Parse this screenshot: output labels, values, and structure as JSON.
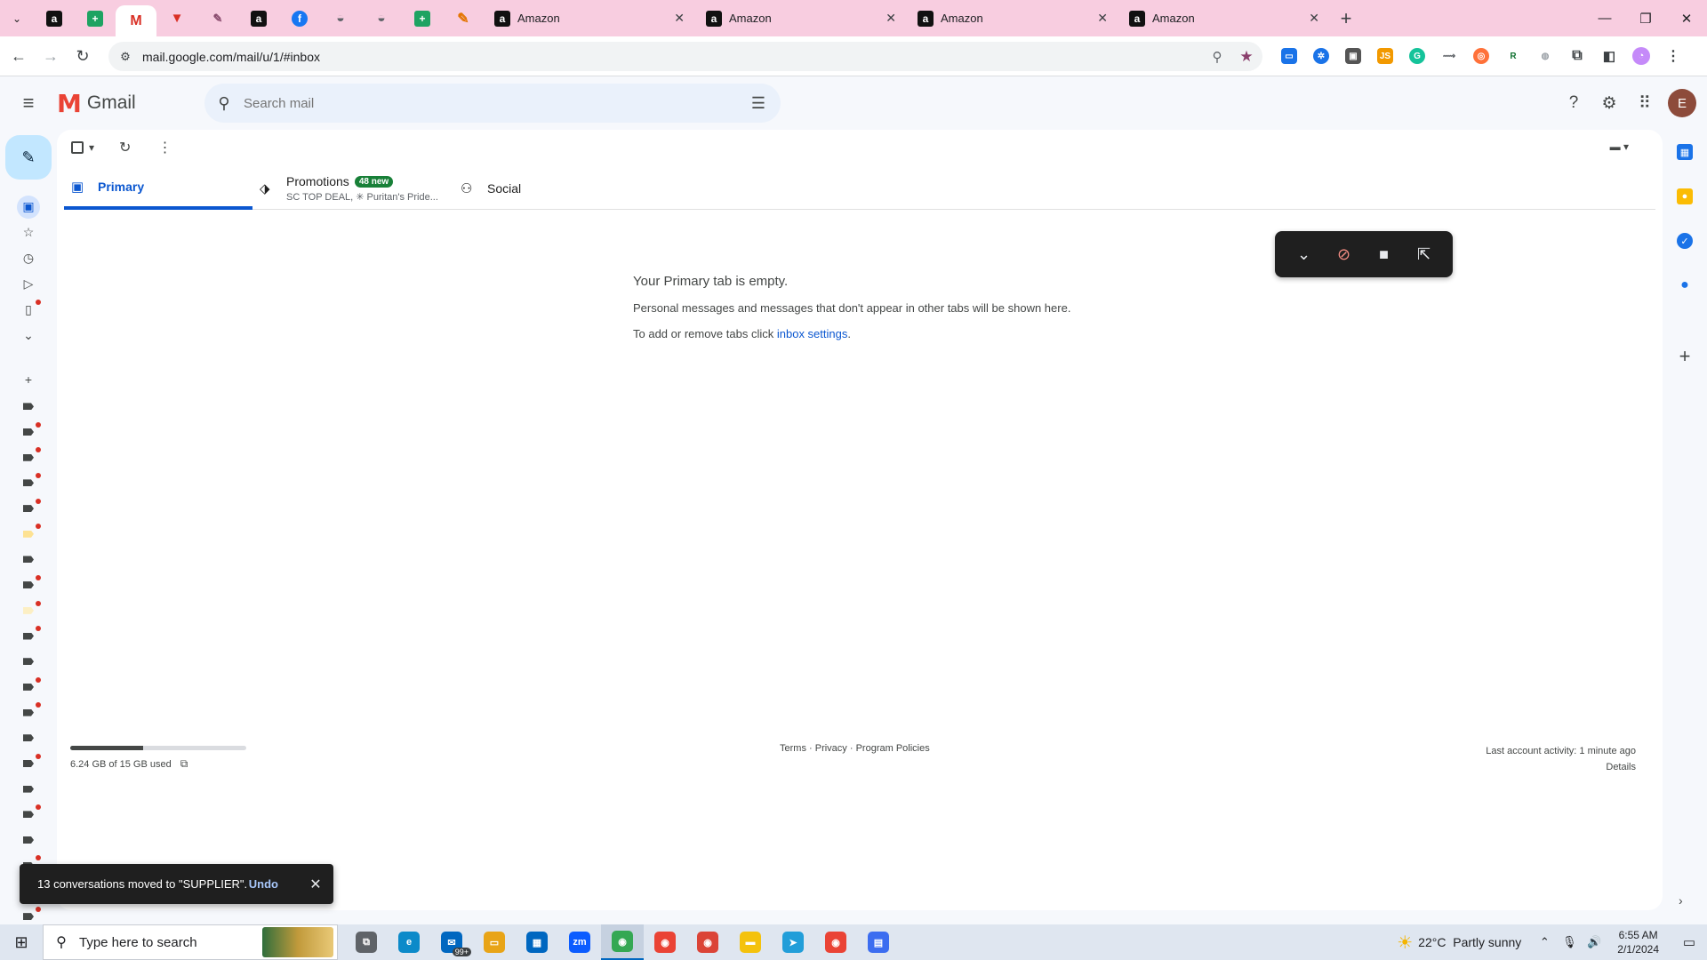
{
  "browser": {
    "pinned_tabs": [
      {
        "icon": "amazon-icon",
        "glyph": "a"
      },
      {
        "icon": "sheets-icon",
        "glyph": "+"
      },
      {
        "icon": "gmail-icon",
        "glyph": "M"
      },
      {
        "icon": "red-v-icon",
        "glyph": "▼"
      },
      {
        "icon": "ms-icon",
        "glyph": "✎"
      },
      {
        "icon": "amazon-icon",
        "glyph": "a"
      },
      {
        "icon": "facebook-icon",
        "glyph": "f"
      },
      {
        "icon": "globe-icon",
        "glyph": "◒"
      },
      {
        "icon": "globe-icon",
        "glyph": "◒"
      },
      {
        "icon": "sheets-icon",
        "glyph": "+"
      },
      {
        "icon": "pen-icon",
        "glyph": "✎"
      }
    ],
    "tabs": [
      {
        "title": "Amazon"
      },
      {
        "title": "Amazon"
      },
      {
        "title": "Amazon"
      },
      {
        "title": "Amazon"
      }
    ],
    "url": "mail.google.com/mail/u/1/#inbox"
  },
  "gmail": {
    "logo_text": "Gmail",
    "search_placeholder": "Search mail",
    "account_initial": "E",
    "inbox_tabs": {
      "primary": "Primary",
      "promotions": "Promotions",
      "promotions_badge": "48 new",
      "promotions_snippet": "SC TOP DEAL, ✳ Puritan's Pride...",
      "social": "Social"
    },
    "empty_state": {
      "title": "Your Primary tab is empty.",
      "line1": "Personal messages and messages that don't appear in other tabs will be shown here.",
      "line2_prefix": "To add or remove tabs click ",
      "line2_link": "inbox settings",
      "line2_suffix": "."
    },
    "storage": {
      "text": "6.24 GB of 15 GB used",
      "fraction": 0.416
    },
    "footer": {
      "terms": "Terms",
      "sep1": " · ",
      "privacy": "Privacy",
      "sep2": " · ",
      "policies": "Program Policies"
    },
    "activity": {
      "line1": "Last account activity: 1 minute ago",
      "details": "Details"
    },
    "snackbar": {
      "message": "13 conversations moved to \"SUPPLIER\".",
      "undo": "Undo"
    }
  },
  "taskbar": {
    "search_placeholder": "Type here to search",
    "mail_badge": "99+",
    "temperature": "22°C",
    "weather": "Partly sunny",
    "time": "6:55 AM",
    "date": "2/1/2024",
    "apps": [
      {
        "name": "task-view-app",
        "glyph": "⧉",
        "color": "#5f6368"
      },
      {
        "name": "edge-app",
        "glyph": "e",
        "color": "#0c8ac9"
      },
      {
        "name": "mail-app",
        "glyph": "✉",
        "color": "#0067c0"
      },
      {
        "name": "file-explorer-app",
        "glyph": "▭",
        "color": "#e8a417"
      },
      {
        "name": "store-app",
        "glyph": "▦",
        "color": "#0067c0"
      },
      {
        "name": "zoom-app",
        "glyph": "zm",
        "color": "#0b5cff"
      },
      {
        "name": "chrome-app",
        "glyph": "◉",
        "color": "#34a853"
      },
      {
        "name": "chrome-profile-app",
        "glyph": "◉",
        "color": "#ea4335"
      },
      {
        "name": "chrome-profile-app-2",
        "glyph": "◉",
        "color": "#db4437"
      },
      {
        "name": "sticky-notes-app",
        "glyph": "▬",
        "color": "#f4c20d"
      },
      {
        "name": "telegram-app",
        "glyph": "➤",
        "color": "#229ed9"
      },
      {
        "name": "chrome-profile-app-3",
        "glyph": "◉",
        "color": "#ea4335"
      },
      {
        "name": "calculator-app",
        "glyph": "▤",
        "color": "#3c6df0"
      }
    ]
  }
}
